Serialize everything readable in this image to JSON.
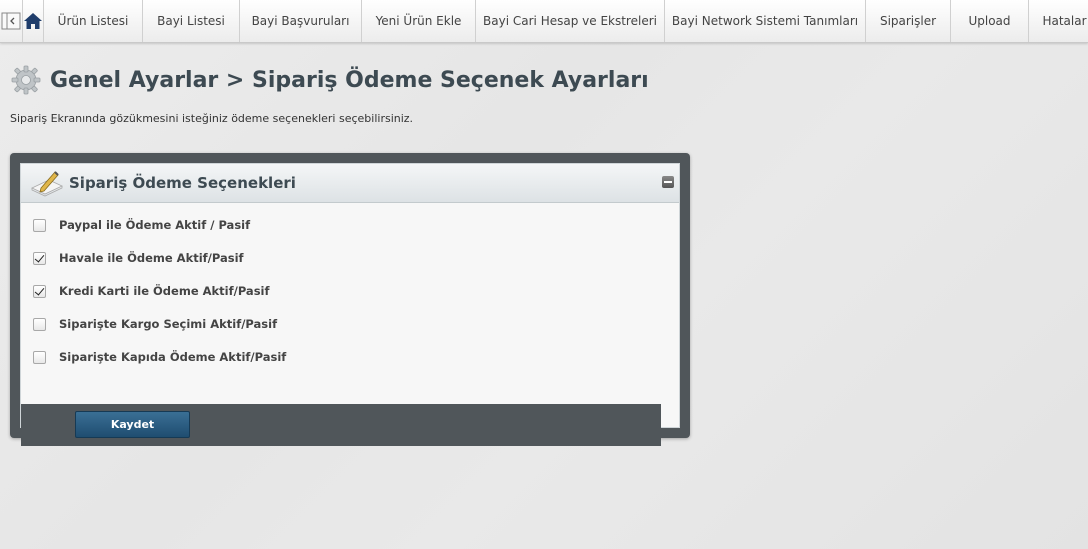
{
  "nav": {
    "items": [
      {
        "label": "Ürün Listesi",
        "width": 82
      },
      {
        "label": "Bayi Listesi",
        "width": 80
      },
      {
        "label": "Bayi Başvuruları",
        "width": 105
      },
      {
        "label": "Yeni Ürün Ekle",
        "width": 97
      },
      {
        "label": "Bayi Cari Hesap ve Ekstreleri",
        "width": 172
      },
      {
        "label": "Bayi Network Sistemi Tanımları",
        "width": 184
      },
      {
        "label": "Siparişler",
        "width": 68
      },
      {
        "label": "Upload",
        "width": 61
      },
      {
        "label": "Hatalar",
        "width": 55
      }
    ]
  },
  "page": {
    "title": "Genel Ayarlar > Sipariş Ödeme Seçenek Ayarları",
    "subtitle": "Sipariş Ekranında gözükmesini isteğiniz ödeme seçenekleri seçebilirsiniz."
  },
  "panel": {
    "title": "Sipariş Ödeme Seçenekleri",
    "options": [
      {
        "label": "Paypal ile Ödeme Aktif / Pasif",
        "checked": false
      },
      {
        "label": "Havale ile Ödeme Aktif/Pasif",
        "checked": true
      },
      {
        "label": "Kredi Karti ile Ödeme Aktif/Pasif",
        "checked": true
      },
      {
        "label": "Siparişte Kargo Seçimi Aktif/Pasif",
        "checked": false
      },
      {
        "label": "Siparişte Kapıda Ödeme Aktif/Pasif",
        "checked": false
      }
    ],
    "save_label": "Kaydet"
  },
  "colors": {
    "title": "#3d4a52",
    "panel_frame": "#50565a",
    "button": "#2a5a7e",
    "home_icon": "#1f3d6b"
  },
  "icons": {
    "collapse-sidebar": "sidebar-toggle-icon",
    "home": "home-icon",
    "page": "gear-icon",
    "panel": "edit-pencil-icon",
    "collapse": "minus-icon"
  }
}
